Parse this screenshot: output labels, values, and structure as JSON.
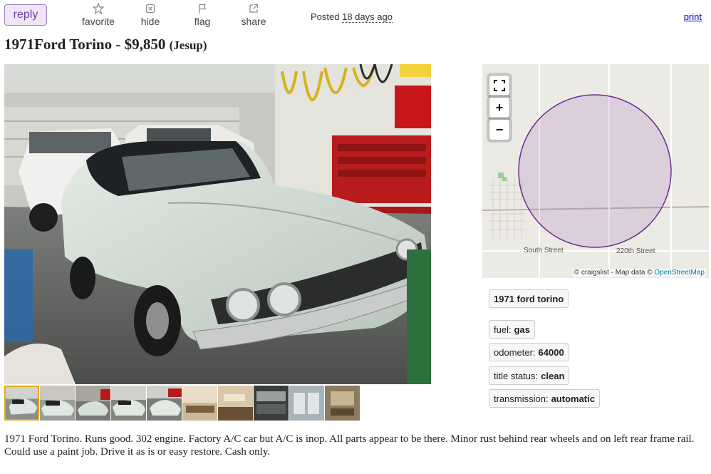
{
  "toolbar": {
    "reply_label": "reply",
    "favorite_label": "favorite",
    "hide_label": "hide",
    "flag_label": "flag",
    "share_label": "share",
    "posted_prefix": "Posted",
    "posted_ago": "18 days ago",
    "print_label": "print"
  },
  "posting": {
    "title": "1971Ford Torino",
    "dash": " - ",
    "price": "$9,850",
    "location": "(Jesup)"
  },
  "map": {
    "expand_icon": "fullscreen-icon",
    "zoom_in": "+",
    "zoom_out": "−",
    "street_south": "South Street",
    "street_220": "220th Street",
    "attribution_prefix": "© craigslist - Map data ©",
    "attribution_link": "OpenStreetMap",
    "circle_color": "#6b2a8e"
  },
  "attributes": {
    "model": "1971 ford torino",
    "fuel_label": "fuel:",
    "fuel_value": "gas",
    "odometer_label": "odometer:",
    "odometer_value": "64000",
    "title_status_label": "title status:",
    "title_status_value": "clean",
    "transmission_label": "transmission:",
    "transmission_value": "automatic"
  },
  "thumbnails": [
    {
      "name": "thumb-1"
    },
    {
      "name": "thumb-2"
    },
    {
      "name": "thumb-3"
    },
    {
      "name": "thumb-4"
    },
    {
      "name": "thumb-5"
    },
    {
      "name": "thumb-6"
    },
    {
      "name": "thumb-7"
    },
    {
      "name": "thumb-8"
    },
    {
      "name": "thumb-9"
    },
    {
      "name": "thumb-10"
    }
  ],
  "description": "1971 Ford Torino. Runs good. 302 engine. Factory A/C car but A/C is inop. All parts appear to be there. Minor rust behind rear wheels and on left rear frame rail. Could use a paint job. Drive it as is or easy restore. Cash only.",
  "colors": {
    "reply_accent": "#6a3fa6",
    "link": "#0000cc",
    "thumb_active": "#e6a91a"
  }
}
